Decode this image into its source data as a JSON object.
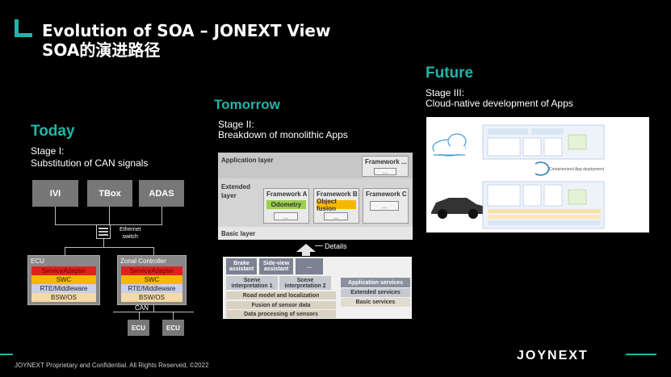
{
  "header": {
    "title_line1": "Evolution of SOA – JONEXT View",
    "title_line2": "SOA的演进路径"
  },
  "today": {
    "heading": "Today",
    "stage": "Stage I:",
    "desc": "Substitution of CAN signals",
    "top_boxes": [
      "IVI",
      "TBox",
      "ADAS"
    ],
    "switch_label_1": "Ethernet",
    "switch_label_2": "switch",
    "ecu_left": {
      "label": "ECU",
      "layers": [
        "ServiceAdapter",
        "SWC",
        "RTE/Middleware",
        "BSW/OS"
      ]
    },
    "ecu_right": {
      "label": "Zonal Controller",
      "layers": [
        "ServiceAdapter",
        "SWC",
        "RTE/Middleware",
        "BSW/OS"
      ]
    },
    "can_label": "CAN",
    "bottom_ecus": [
      "ECU",
      "ECU"
    ],
    "colors": {
      "service_adapter": "#e02020",
      "swc": "#f5b800",
      "rte": "#c9cfe6",
      "bsw": "#f5d9a8"
    }
  },
  "tomorrow": {
    "heading": "Tomorrow",
    "stage": "Stage II:",
    "desc": "Breakdown of monolithic Apps",
    "app_layer": "Application layer",
    "framework_dots": "Framework ...",
    "ext_layer_1": "Extended",
    "ext_layer_2": "layer",
    "frameworks": [
      {
        "name": "Framework A",
        "sub": "Odometry"
      },
      {
        "name": "Framework B",
        "sub": "Object fusion"
      },
      {
        "name": "Framework C",
        "sub": ""
      }
    ],
    "ellipsis": "...",
    "basic_layer": "Basic layer",
    "details": "Details",
    "detail_items": {
      "brake": "Brake assistant",
      "side_view": "Side-view assistant",
      "more": "...",
      "scene1": "Scene interpretation 1",
      "scene2": "Scene interpretation 2",
      "road": "Road model and localization",
      "fusion": "Fusion of sensor data",
      "processing": "Data processing of sensors",
      "app_services": "Application services",
      "ext_services": "Extended services",
      "basic_services": "Basic services"
    }
  },
  "future": {
    "heading": "Future",
    "stage": "Stage III:",
    "desc": "Cloud-native development of Apps",
    "diagram_label": "Containerized App deployment"
  },
  "footer": {
    "text": "JOYNEXT Proprietary and Confidential. All Rights Reserved, ©2022",
    "logo": "JOYNEXT"
  }
}
